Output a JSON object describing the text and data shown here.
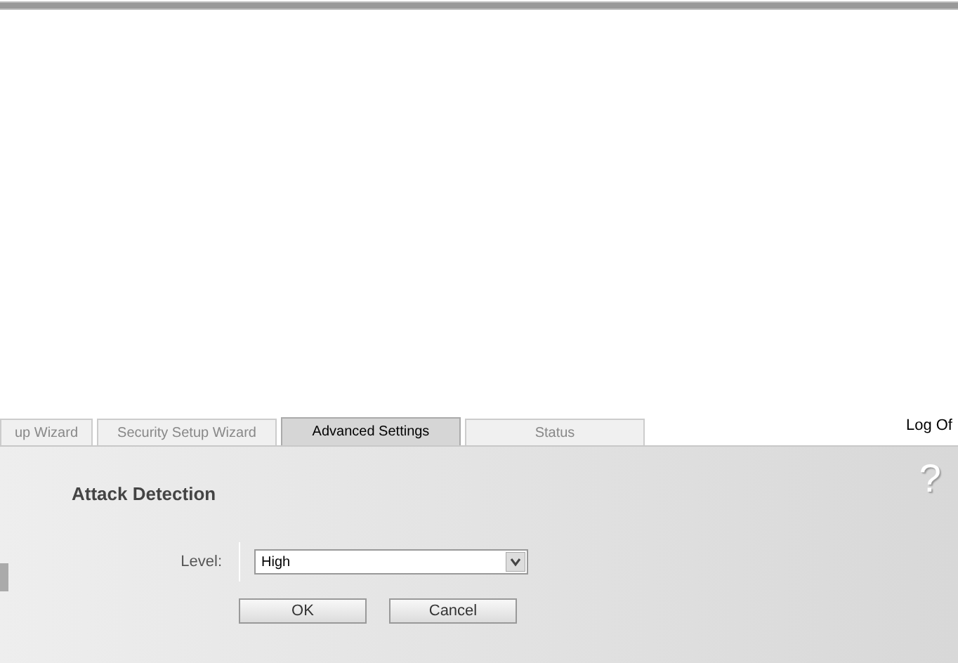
{
  "tabs": [
    {
      "label": "up Wizard",
      "selected": false
    },
    {
      "label": "Security Setup Wizard",
      "selected": false
    },
    {
      "label": "Advanced Settings",
      "selected": true
    },
    {
      "label": "Status",
      "selected": false
    }
  ],
  "logoff": "Log Of",
  "panel": {
    "title": "Attack Detection",
    "help": "?",
    "level": {
      "label": "Level:",
      "value": "High"
    },
    "buttons": [
      "OK",
      "Cancel"
    ]
  }
}
